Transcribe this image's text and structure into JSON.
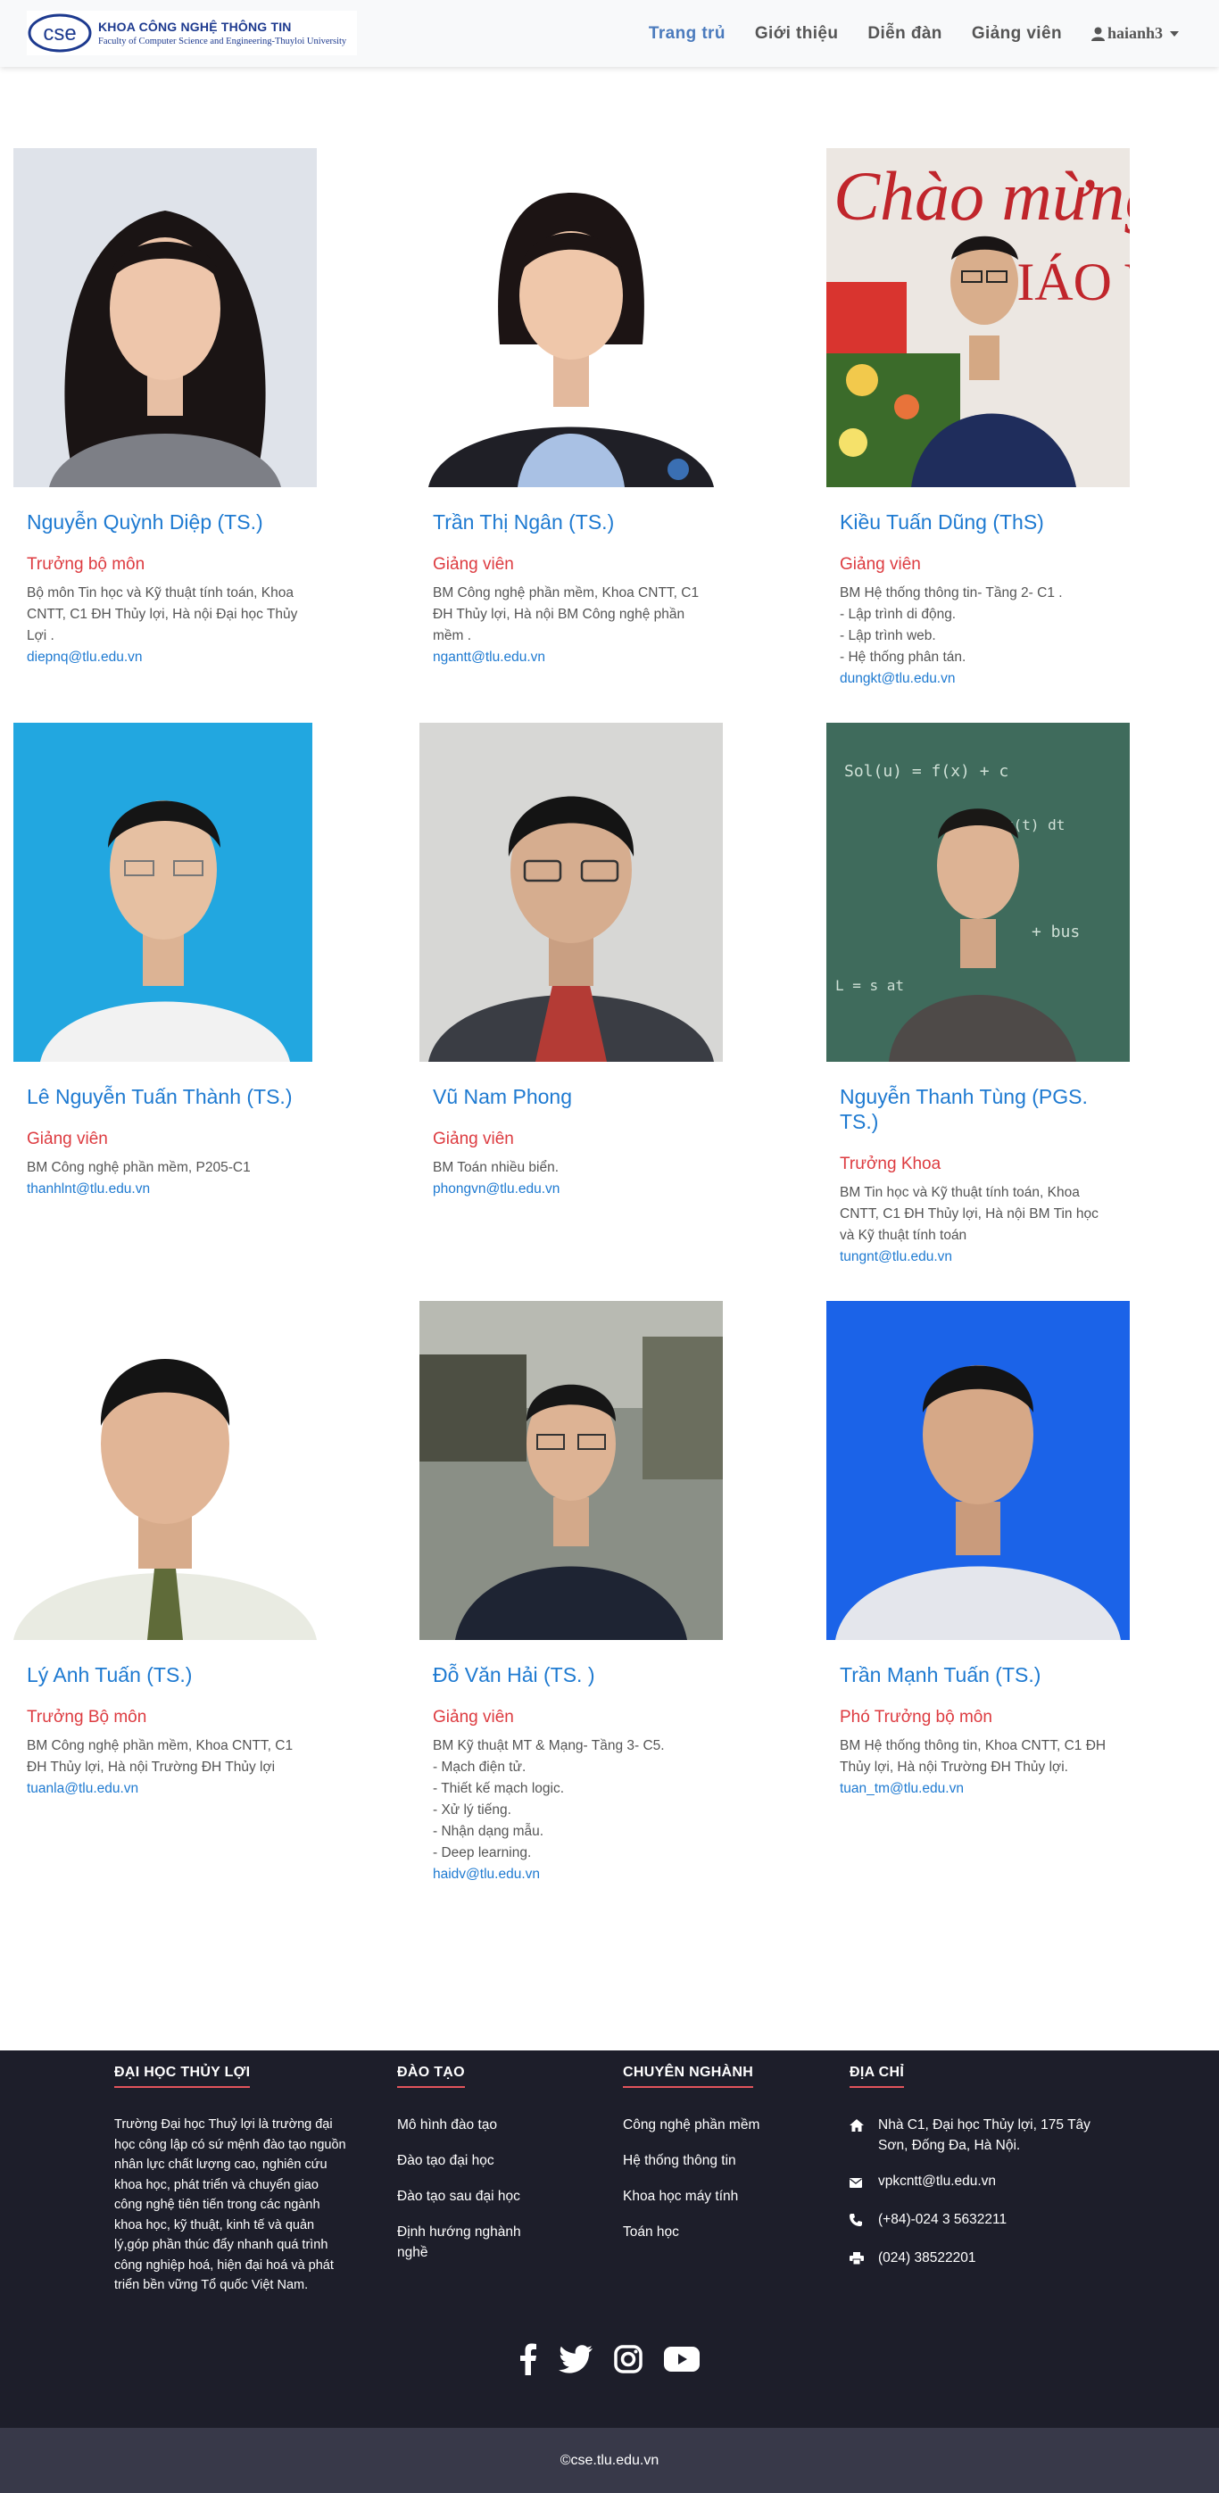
{
  "header": {
    "logo": {
      "mark": "cse",
      "title": "KHOA CÔNG NGHỆ THÔNG TIN",
      "subtitle": "Faculty of Computer Science and Engineering-Thuyloi University"
    },
    "nav": [
      {
        "label": "Trang trủ",
        "active": true
      },
      {
        "label": "Giới thiệu",
        "active": false
      },
      {
        "label": "Diễn đàn",
        "active": false
      },
      {
        "label": "Giảng viên",
        "active": false
      }
    ],
    "user": {
      "name": "haianh3",
      "icon": "user-icon"
    }
  },
  "lecturers": [
    {
      "name": "Nguyễn Quỳnh Diệp (TS.)",
      "role": "Trưởng bộ môn",
      "desc": "Bộ môn Tin học và Kỹ thuật tính toán, Khoa CNTT, C1 ĐH Thủy lợi, Hà nội Đại học Thủy Lợi .",
      "email": "diepnq@tlu.edu.vn"
    },
    {
      "name": "Trần Thị Ngân (TS.)",
      "role": "Giảng viên",
      "desc": "BM Công nghệ phần mềm, Khoa CNTT, C1 ĐH Thủy lợi, Hà nội BM Công nghệ phần mềm .",
      "email": "ngantt@tlu.edu.vn"
    },
    {
      "name": "Kiều Tuấn Dũng (ThS)",
      "role": "Giảng viên",
      "desc": "BM Hệ thống thông tin- Tầng 2- C1 .\n- Lập trình di động.\n- Lập trình web.\n- Hệ thống phân tán.",
      "email": "dungkt@tlu.edu.vn"
    },
    {
      "name": "Lê Nguyễn Tuấn Thành (TS.)",
      "role": "Giảng viên",
      "desc": "BM Công nghệ phần mềm, P205-C1",
      "email": "thanhlnt@tlu.edu.vn"
    },
    {
      "name": "Vũ Nam Phong",
      "role": "Giảng viên",
      "desc": "BM Toán nhiều biển.",
      "email": "phongvn@tlu.edu.vn"
    },
    {
      "name": "Nguyễn Thanh Tùng (PGS. TS.)",
      "role": "Trưởng Khoa",
      "desc": "BM Tin học và Kỹ thuật tính toán, Khoa CNTT, C1 ĐH Thủy lợi, Hà nội BM Tin học và Kỹ thuật tính toán",
      "email": "tungnt@tlu.edu.vn"
    },
    {
      "name": "Lý Anh Tuấn (TS.)",
      "role": "Trưởng Bộ môn",
      "desc": "BM Công nghệ phần mềm, Khoa CNTT, C1 ĐH Thủy lợi, Hà nội Trường ĐH Thủy lợi",
      "email": "tuanla@tlu.edu.vn"
    },
    {
      "name": "Đỗ Văn Hải (TS. )",
      "role": "Giảng viên",
      "desc": "BM Kỹ thuật MT & Mạng- Tầng 3- C5.\n- Mạch điện tử.\n- Thiết kế mạch logic.\n- Xử lý tiếng.\n- Nhận dạng mẫu.\n- Deep learning.\n ",
      "email": "haidv@tlu.edu.vn"
    },
    {
      "name": "Trần Mạnh Tuấn (TS.)",
      "role": "Phó Trưởng bộ môn",
      "desc": "BM Hệ thống thông tin, Khoa CNTT, C1 ĐH Thủy lợi, Hà nội Trường ĐH Thủy lợi.",
      "email": "tuan_tm@tlu.edu.vn"
    }
  ],
  "footer": {
    "about": {
      "heading": "ĐẠI HỌC THỦY LỢI",
      "text": "Trường Đại học Thuỷ lợi là trường đại học công lập có sứ mệnh đào tạo nguồn nhân lực chất lượng cao, nghiên cứu khoa học, phát triển và chuyển giao công nghệ tiên tiến trong các ngành khoa học, kỹ thuật, kinh tế và quản lý,góp phần thúc đẩy nhanh quá trình công nghiệp hoá, hiện đại hoá và phát triển bền vững Tổ quốc Việt Nam."
    },
    "training": {
      "heading": "ĐÀO TẠO",
      "items": [
        "Mô hình đào tạo",
        "Đào tạo đại học",
        "Đào tạo sau đại học",
        "Định hướng nghành nghề"
      ]
    },
    "majors": {
      "heading": "CHUYÊN NGHÀNH",
      "items": [
        "Công nghệ phần mềm",
        "Hệ thống thông tin",
        "Khoa học máy tính",
        "Toán học"
      ]
    },
    "contact": {
      "heading": "ĐỊA CHỈ",
      "items": [
        {
          "icon": "home-icon",
          "text": "Nhà C1, Đại học Thủy lợi, 175 Tây Sơn, Đống Đa, Hà Nội."
        },
        {
          "icon": "envelope-icon",
          "text": "vpkcntt@tlu.edu.vn"
        },
        {
          "icon": "phone-icon",
          "text": "(+84)-024 3 5632211"
        },
        {
          "icon": "printer-icon",
          "text": "(024) 38522201"
        }
      ]
    },
    "social": [
      "facebook-icon",
      "twitter-icon",
      "instagram-icon",
      "youtube-icon"
    ],
    "copyright": "©cse.tlu.edu.vn"
  },
  "colors": {
    "accent_blue": "#1e7ad1",
    "role_red": "#dd3b40",
    "footer_bg": "#1d1e2a",
    "bottom_bg": "#383949",
    "nav_active": "#4b7bbd"
  }
}
